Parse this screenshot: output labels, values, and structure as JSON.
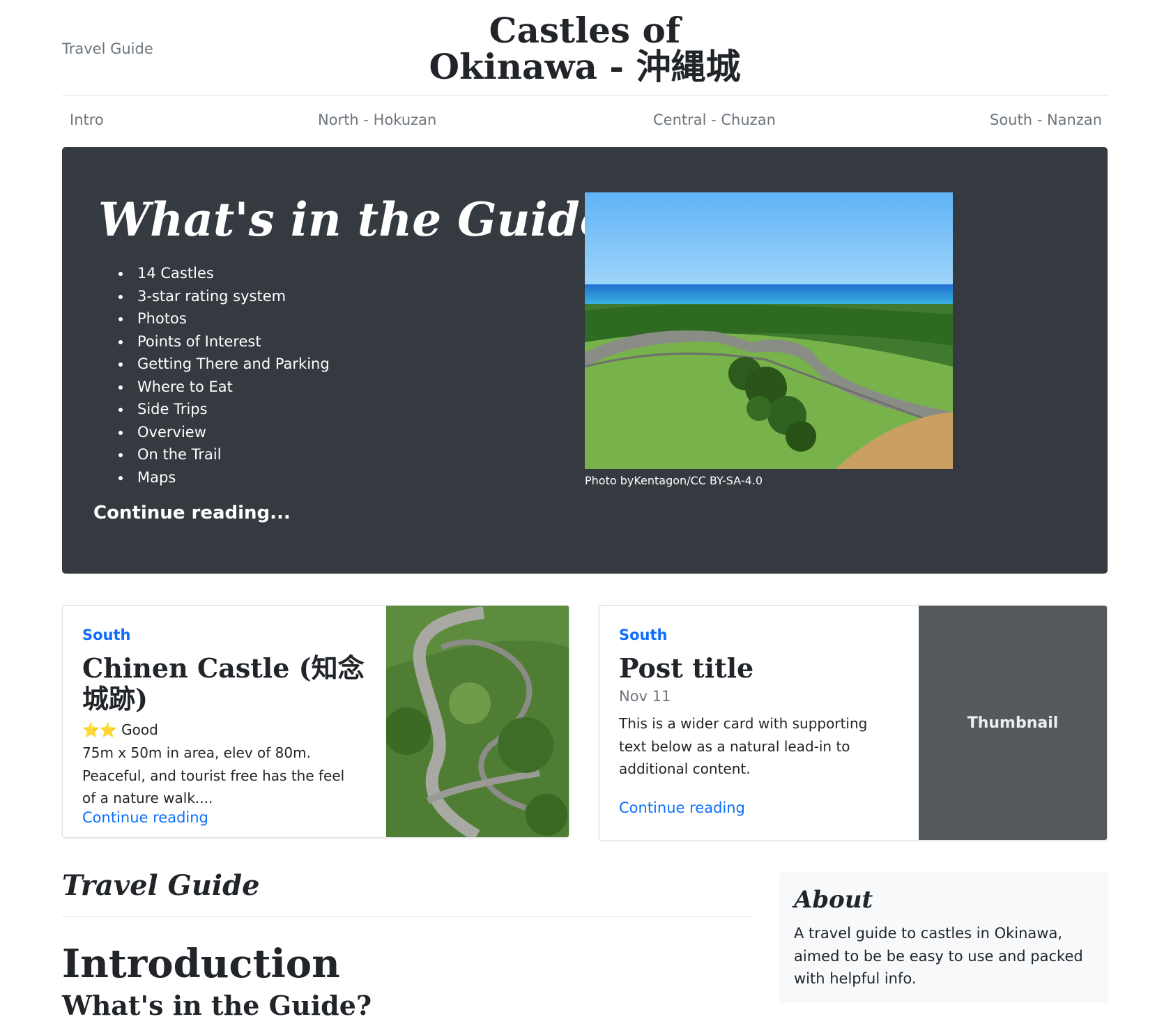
{
  "header": {
    "link": "Travel Guide",
    "title": "Castles of Okinawa - 沖縄城"
  },
  "nav": {
    "items": [
      "Intro",
      "North - Hokuzan",
      "Central - Chuzan",
      "South - Nanzan"
    ]
  },
  "jumbotron": {
    "title": "What's in the Guide?",
    "list": [
      "14 Castles",
      "3-star rating system",
      "Photos",
      "Points of Interest",
      "Getting There and Parking",
      "Where to Eat",
      "Side Trips",
      "Overview",
      "On the Trail",
      "Maps"
    ],
    "cta": "Continue reading...",
    "photo_credit": "Photo byKentagon/CC BY-SA-4.0"
  },
  "cards": [
    {
      "category": "South",
      "title": "Chinen Castle (知念城跡)",
      "rating_stars": "⭐⭐",
      "rating_label": "Good",
      "desc_1": "75m x 50m in area, elev of 80m.",
      "desc_2": "Peaceful, and tourist free has the feel of a nature walk....",
      "link": "Continue reading"
    },
    {
      "category": "South",
      "title": "Post title",
      "date": "Nov 11",
      "text": "This is a wider card with supporting text below as a natural lead-in to additional content.",
      "link": "Continue reading",
      "thumb_label": "Thumbnail"
    }
  ],
  "main": {
    "section_title": "Travel Guide",
    "intro_title": "Introduction",
    "intro_subtitle": "What's in the Guide?"
  },
  "about": {
    "title": "About",
    "text": "A travel guide to castles in Okinawa, aimed to be be easy to use and packed with helpful info."
  },
  "colors": {
    "jumbo_bg": "#343a40",
    "link_blue": "#0d6efd",
    "thumb_bg": "#55595c"
  }
}
